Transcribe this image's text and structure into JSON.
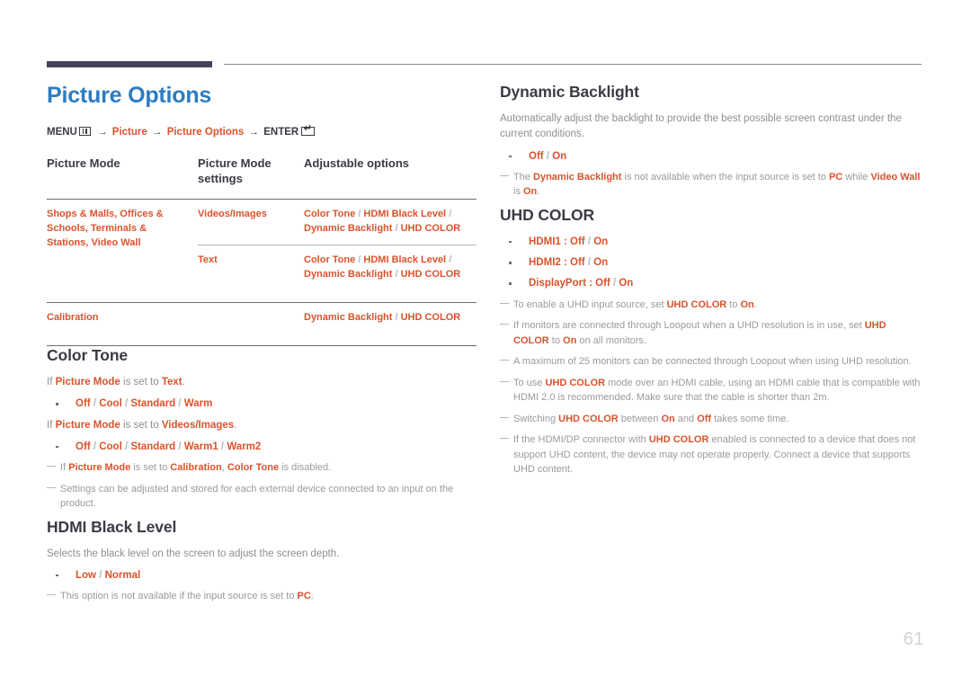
{
  "document": {
    "page_number": "61",
    "accent_blue": "#2b7cc3",
    "accent_orange": "#d9532c",
    "rule_navy": "#43435c"
  },
  "left": {
    "title": "Picture Options",
    "menu_path": {
      "menu_label": "MENU",
      "menu_icon": "menu-grid-icon",
      "arrow": "→",
      "crumb1": "Picture",
      "crumb2": "Picture Options",
      "enter_label": "ENTER",
      "enter_icon": "enter-key-icon"
    },
    "table": {
      "headers": [
        "Picture Mode",
        "Picture Mode settings",
        "Adjustable options"
      ],
      "rows": [
        {
          "mode": "Shops & Malls, Offices & Schools, Terminals & Stations, Video Wall",
          "setting": "Videos/Images",
          "options": "Color Tone / HDMI Black Level / Dynamic Backlight / UHD COLOR"
        },
        {
          "mode": "",
          "setting": "Text",
          "options": "Color Tone / HDMI Black Level / Dynamic Backlight / UHD COLOR"
        },
        {
          "mode": "Calibration",
          "setting": "",
          "options": "Dynamic Backlight / UHD COLOR"
        }
      ]
    },
    "color_tone": {
      "heading": "Color Tone",
      "line1_pre": "If ",
      "line1_a": "Picture Mode",
      "line1_mid": " is set to ",
      "line1_b": "Text",
      "line1_end": ".",
      "bullet1": "Off / Cool / Standard / Warm",
      "line2_pre": "If ",
      "line2_a": "Picture Mode",
      "line2_mid": " is set to ",
      "line2_b": "Videos/Images",
      "line2_end": ".",
      "bullet2": "Off / Cool / Standard / Warm1 / Warm2",
      "note1_pre": "If ",
      "note1_a": "Picture Mode",
      "note1_mid": " is set to ",
      "note1_b": "Calibration",
      "note1_mid2": ", ",
      "note1_c": "Color Tone",
      "note1_end": " is disabled.",
      "note2": "Settings can be adjusted and stored for each external device connected to an input on the product."
    },
    "hdmi_black_level": {
      "heading": "HDMI Black Level",
      "description": "Selects the black level on the screen to adjust the screen depth.",
      "bullet": "Low / Normal",
      "note_pre": "This option is not available if the input source is set to ",
      "note_hl": "PC",
      "note_end": "."
    }
  },
  "right": {
    "dynamic_backlight": {
      "heading": "Dynamic Backlight",
      "description": "Automatically adjust the backlight to provide the best possible screen contrast under the current conditions.",
      "bullet": "Off / On",
      "note_pre": "The ",
      "note_a": "Dynamic Backlight",
      "note_mid": " is not available when the input source is set to ",
      "note_b": "PC",
      "note_mid2": " while ",
      "note_c": "Video Wall",
      "note_mid3": " is ",
      "note_d": "On",
      "note_end": "."
    },
    "uhd_color": {
      "heading": "UHD COLOR",
      "bullets": [
        {
          "label": "HDMI1",
          "sep": " : ",
          "values": "Off / On"
        },
        {
          "label": "HDMI2",
          "sep": " : ",
          "values": "Off / On"
        },
        {
          "label": "DisplayPort",
          "sep": " : ",
          "values": "Off / On"
        }
      ],
      "note1_pre": "To enable a UHD input source, set ",
      "note1_a": "UHD COLOR",
      "note1_mid": " to ",
      "note1_b": "On",
      "note1_end": ".",
      "note2_pre": "If monitors are connected through Loopout when a UHD resolution is in use, set ",
      "note2_a": "UHD COLOR",
      "note2_mid": " to ",
      "note2_b": "On",
      "note2_end": " on all monitors.",
      "note3": "A maximum of 25 monitors can be connected through Loopout when using UHD resolution.",
      "note4_pre": "To use ",
      "note4_a": "UHD COLOR",
      "note4_end": " mode over an HDMI cable, using an HDMI cable that is compatible with HDMI 2.0 is recommended. Make sure that the cable is shorter than 2m.",
      "note5_pre": "Switching ",
      "note5_a": "UHD COLOR",
      "note5_mid": " between ",
      "note5_b": "On",
      "note5_mid2": " and ",
      "note5_c": "Off",
      "note5_end": " takes some time.",
      "note6_pre": "If the HDMI/DP connector with ",
      "note6_a": "UHD COLOR",
      "note6_end": " enabled is connected to a device that does not support UHD content, the device may not operate properly. Connect a device that supports UHD content."
    }
  }
}
